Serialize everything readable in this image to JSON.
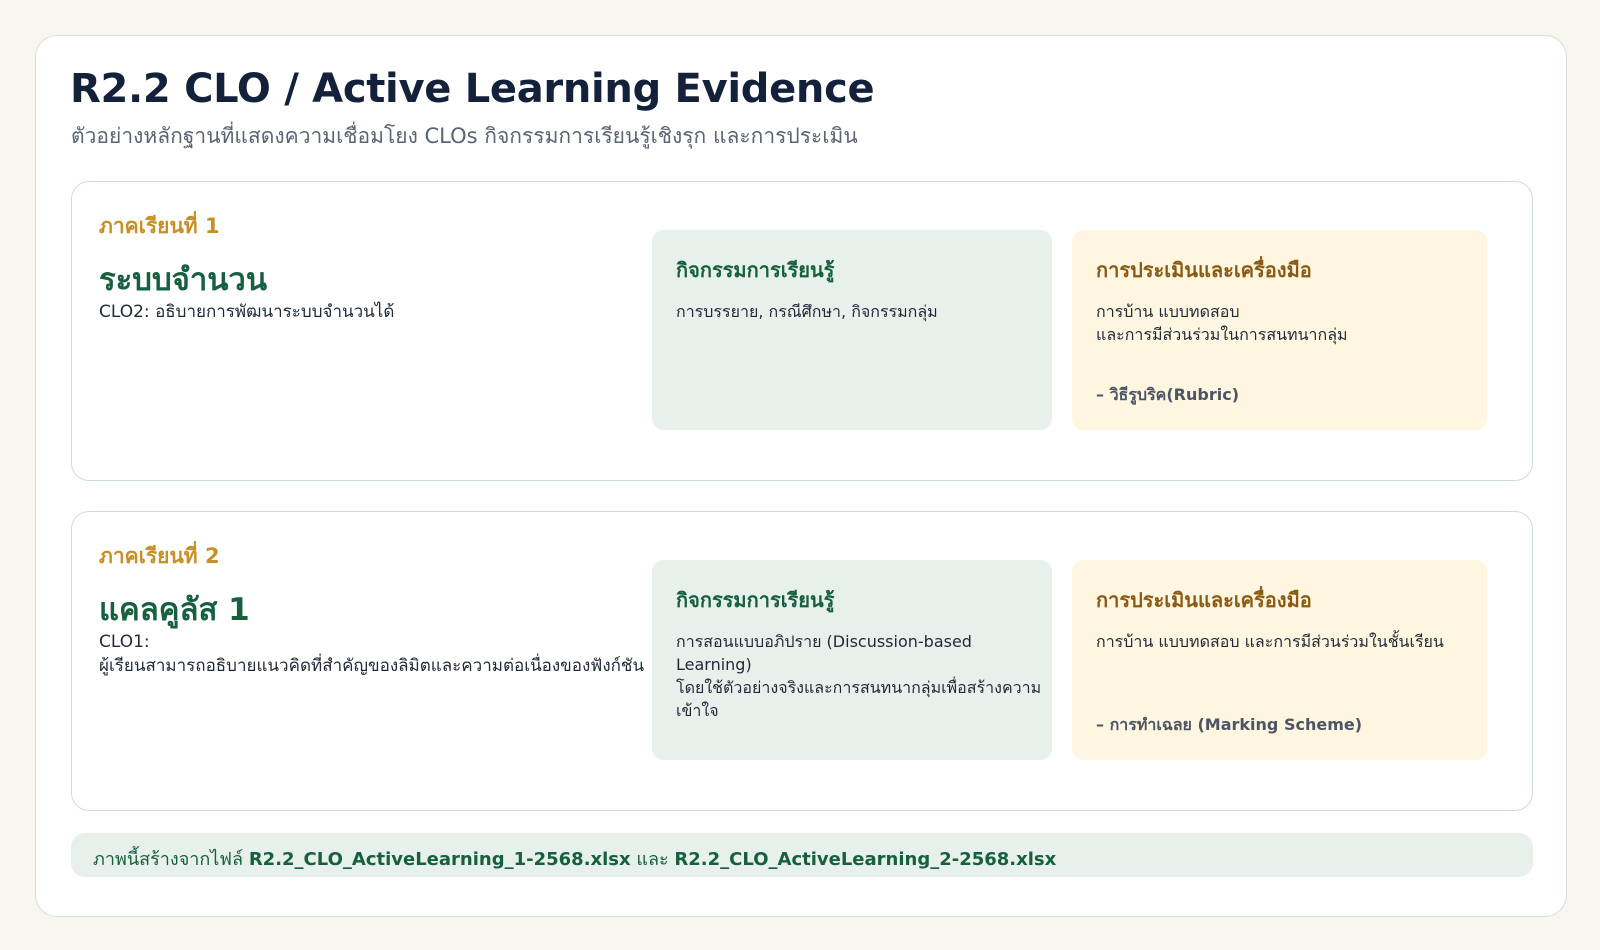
{
  "header": {
    "title": "R2.2 CLO / Active Learning Evidence",
    "subtitle": "ตัวอย่างหลักฐานที่แสดงความเชื่อมโยง CLOs กิจกรรมการเรียนรู้เชิงรุก และการประเมิน"
  },
  "terms": [
    {
      "term_label": "ภาคเรียนที่ 1",
      "course": "ระบบจำนวน",
      "clo": "CLO2: อธิบายการพัฒนาระบบจำนวนได้",
      "activity_title": "กิจกรรมการเรียนรู้",
      "activity_text": "การบรรยาย, กรณีศึกษา, กิจกรรมกลุ่ม",
      "eval_title": "การประเมินและเครื่องมือ",
      "eval_text": "การบ้าน แบบทดสอบ\nและการมีส่วนร่วมในการสนทนากลุ่ม",
      "eval_tool": "– วิธีรูบริค(Rubric)"
    },
    {
      "term_label": "ภาคเรียนที่ 2",
      "course": "แคลคูลัส 1",
      "clo": "CLO1:\nผู้เรียนสามารถอธิบายแนวคิดที่สำคัญของลิมิตและความต่อเนื่องของฟังก์ชัน",
      "activity_title": "กิจกรรมการเรียนรู้",
      "activity_text": "การสอนแบบอภิปราย (Discussion-based\nLearning)\nโดยใช้ตัวอย่างจริงและการสนทนากลุ่มเพื่อสร้างความเข้าใจ",
      "eval_title": "การประเมินและเครื่องมือ",
      "eval_text": "การบ้าน แบบทดสอบ และการมีส่วนร่วมในชั้นเรียน",
      "eval_tool": "– การทำเฉลย (Marking Scheme)"
    }
  ],
  "footer": {
    "lead": "ภาพนี้สร้างจากไฟล์",
    "file1": "R2.2_CLO_ActiveLearning_1-2568.xlsx",
    "conj": "และ",
    "file2": "R2.2_CLO_ActiveLearning_2-2568.xlsx"
  },
  "colors": {
    "background": "#f9f6ef",
    "title": "#13223a",
    "term_label": "#c88f26",
    "course": "#17603f",
    "activity_panel": "#e8f0ec",
    "eval_panel": "#fff6e1"
  }
}
